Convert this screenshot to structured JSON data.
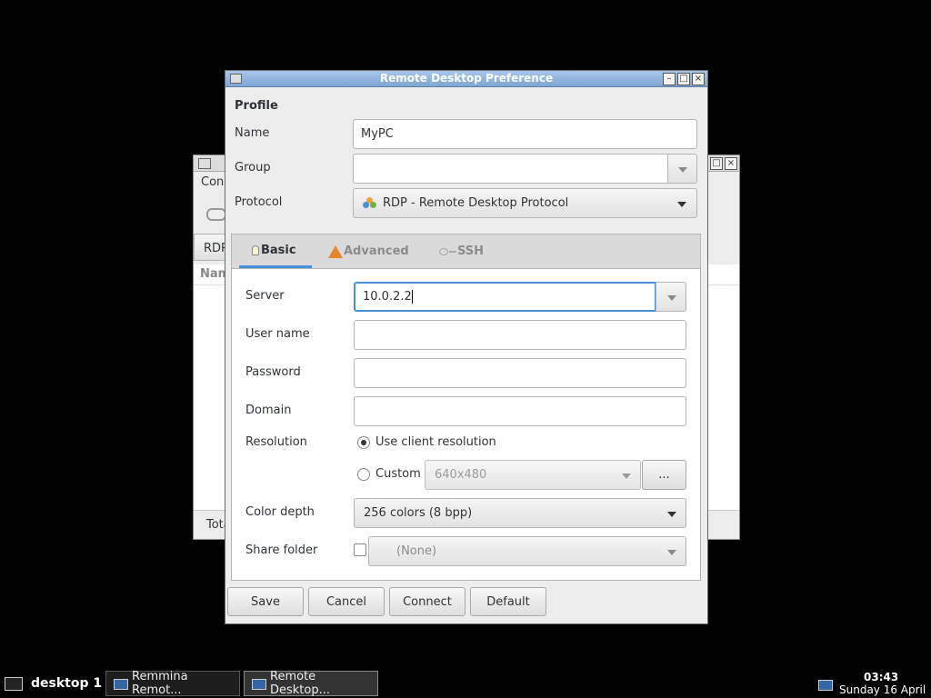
{
  "dialog": {
    "title": "Remote Desktop Preference",
    "profile_heading": "Profile",
    "name_label": "Name",
    "name_value": "MyPC",
    "group_label": "Group",
    "group_value": "",
    "protocol_label": "Protocol",
    "protocol_value": "RDP - Remote Desktop Protocol",
    "tabs": [
      {
        "label": "Basic",
        "active": true
      },
      {
        "label": "Advanced",
        "active": false
      },
      {
        "label": "SSH",
        "active": false
      }
    ],
    "basic": {
      "server_label": "Server",
      "server_value": "10.0.2.2",
      "username_label": "User name",
      "username_value": "",
      "password_label": "Password",
      "password_value": "",
      "domain_label": "Domain",
      "domain_value": "",
      "resolution_label": "Resolution",
      "resolution_options": {
        "client": "Use client resolution",
        "custom": "Custom",
        "selected": "client"
      },
      "custom_resolution_value": "640x480",
      "custom_more_button": "...",
      "color_depth_label": "Color depth",
      "color_depth_value": "256 colors (8 bpp)",
      "share_folder_label": "Share folder",
      "share_folder_checked": false,
      "share_folder_value": "(None)"
    },
    "buttons": {
      "save": "Save",
      "cancel": "Cancel",
      "connect": "Connect",
      "default": "Default"
    }
  },
  "background_window": {
    "menu_fragment": "Con",
    "tab_fragment": "RDP",
    "column_fragment": "Nam",
    "status_fragment": "Tota"
  },
  "taskbar": {
    "desktop_label": "desktop 1",
    "tasks": [
      {
        "label": "Remmina Remot...",
        "active": false
      },
      {
        "label": "Remote Desktop...",
        "active": true
      }
    ],
    "clock_time": "03:43",
    "clock_date": "Sunday 16 April"
  },
  "colors": {
    "desktop_background": "#000000",
    "titlebar_blue": "#7fa6d3",
    "tab_underline": "#4a90d9",
    "focus_border": "#4a90d9"
  }
}
